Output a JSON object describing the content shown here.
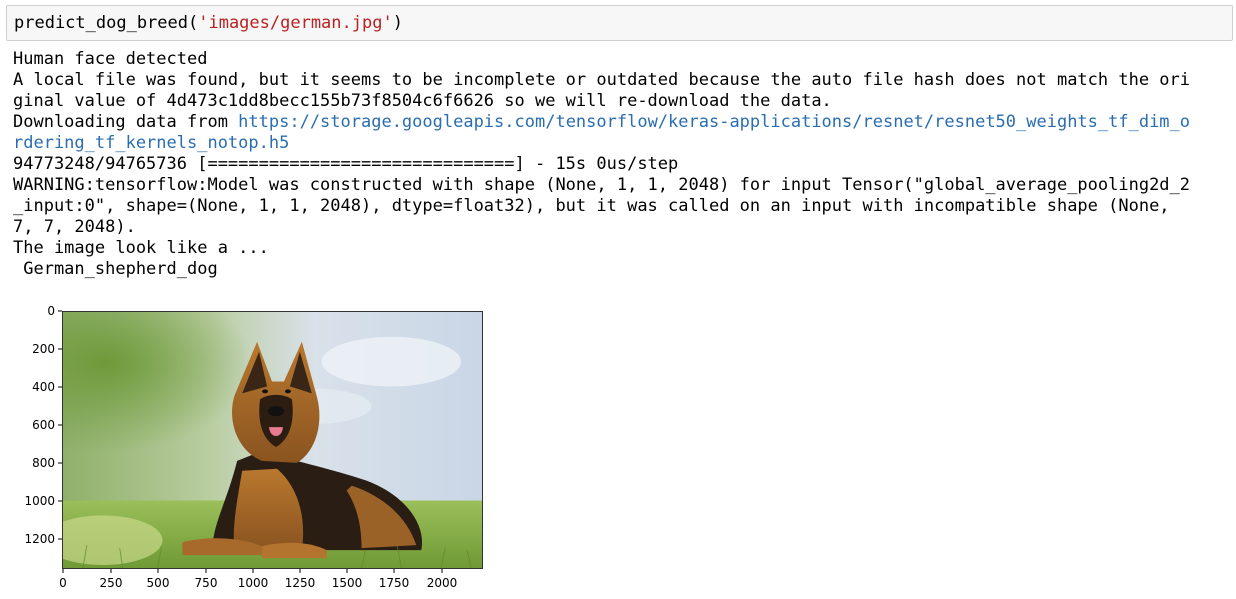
{
  "input_cell": {
    "code_prefix": "predict_dog_breed(",
    "code_arg": "'images/german.jpg'",
    "code_suffix": ")"
  },
  "output": {
    "line1": "Human face detected",
    "line2": "A local file was found, but it seems to be incomplete or outdated because the auto file hash does not match the ori",
    "line3": "ginal value of 4d473c1dd8becc155b73f8504c6f6626 so we will re-download the data.",
    "line4_prefix": "Downloading data from ",
    "line4_link": "https://storage.googleapis.com/tensorflow/keras-applications/resnet/resnet50_weights_tf_dim_o",
    "line5_link": "rdering_tf_kernels_notop.h5",
    "line6": "94773248/94765736 [==============================] - 15s 0us/step",
    "line7": "WARNING:tensorflow:Model was constructed with shape (None, 1, 1, 2048) for input Tensor(\"global_average_pooling2d_2",
    "line8": "_input:0\", shape=(None, 1, 1, 2048), dtype=float32), but it was called on an input with incompatible shape (None,",
    "line9": "7, 7, 2048).",
    "line10": "The image look like a ...",
    "line11": " German_shepherd_dog"
  },
  "figure": {
    "y_ticks": [
      "0",
      "200",
      "400",
      "600",
      "800",
      "1000",
      "1200"
    ],
    "x_ticks": [
      "0",
      "250",
      "500",
      "750",
      "1000",
      "1250",
      "1500",
      "1750",
      "2000"
    ],
    "image_subject": "German shepherd dog lying on grass"
  }
}
